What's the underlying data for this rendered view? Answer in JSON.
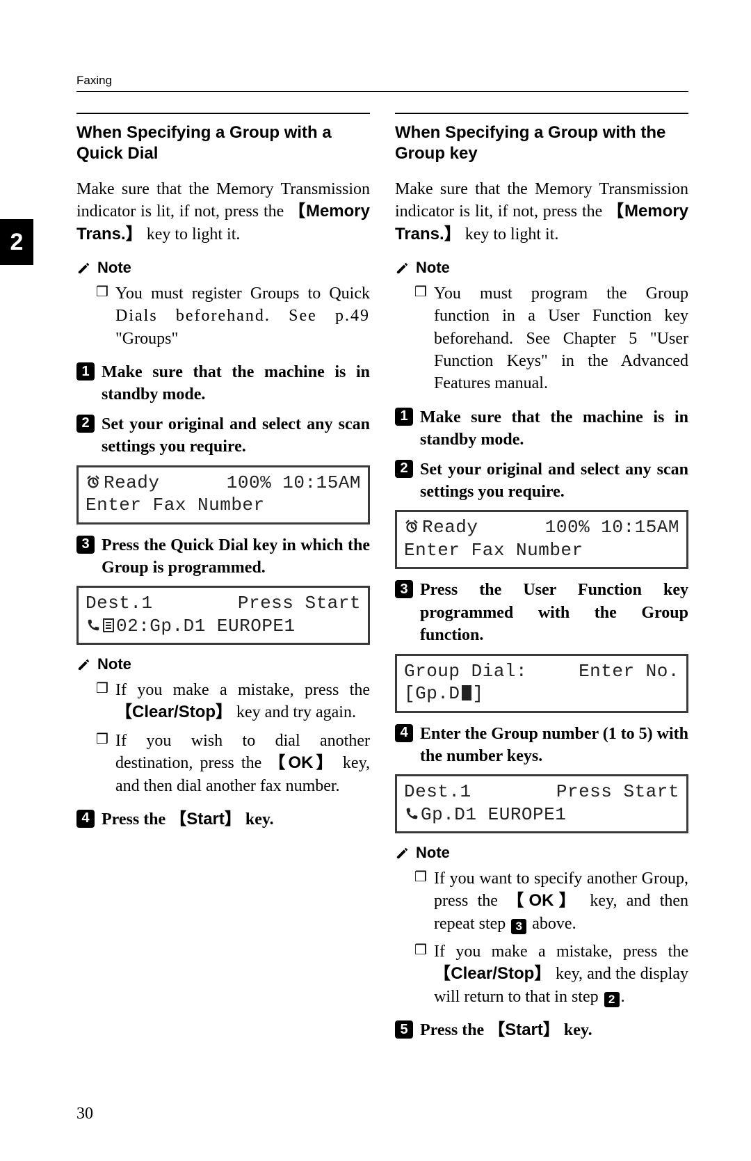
{
  "page": {
    "number": "30",
    "running_header": "Faxing",
    "tab_label": "2"
  },
  "keys": {
    "memory_trans": "Memory Trans.",
    "clear_stop": "Clear/Stop",
    "ok": "OK",
    "start": "Start"
  },
  "note_label": "Note",
  "left": {
    "heading": "When Specifying a Group with a Quick Dial",
    "intro_pre": "Make sure that the Memory Transmission indicator is lit, if not, press the ",
    "intro_post": " key to light it.",
    "note1_pre": "You must register Groups to Quick ",
    "note1_tracked": "Dials beforehand. See p.49",
    "note1_post": " \"Groups\"",
    "step1": "Make sure that the machine is in standby mode.",
    "step2": "Set your original and select any scan settings you require.",
    "lcd1": {
      "row1_left": "Ready",
      "row1_right": "100% 10:15AM",
      "row2": "Enter Fax Number"
    },
    "step3": "Press the Quick Dial key in which the Group is programmed.",
    "lcd2": {
      "row1_left": "Dest.1",
      "row1_right": "Press Start",
      "row2": "02:Gp.D1 EUROPE1"
    },
    "note2_a_pre": "If you make a mistake, press the ",
    "note2_a_post": " key and try again.",
    "note2_b_pre": "If you wish to dial another destination, press the ",
    "note2_b_post": " key, and then dial another fax number.",
    "step4_pre": "Press the ",
    "step4_post": " key."
  },
  "right": {
    "heading": "When Specifying a Group with the Group key",
    "intro_pre": "Make sure that the Memory Transmission indicator is lit, if not, press the ",
    "intro_post": " key to light it.",
    "note1": "You must program the Group function in a User Function key beforehand. See Chapter 5 \"User Function Keys\" in the Advanced Features manual.",
    "step1": "Make sure that the machine is in standby mode.",
    "step2": "Set your original and select any scan settings you require.",
    "lcd1": {
      "row1_left": "Ready",
      "row1_right": "100% 10:15AM",
      "row2": "Enter Fax Number"
    },
    "step3": "Press the User Function key programmed with the Group function.",
    "lcd2": {
      "row1_left": "Group Dial:",
      "row1_right": "Enter No.",
      "row2_pre": "[Gp.D",
      "row2_post": "]"
    },
    "step4": "Enter the Group number (1 to 5) with the number keys.",
    "lcd3": {
      "row1_left": "Dest.1",
      "row1_right": "Press Start",
      "row2": "Gp.D1 EUROPE1"
    },
    "note2_a_pre": "If you want to specify another Group, press the ",
    "note2_a_mid": " key, and then repeat step ",
    "note2_a_step": "3",
    "note2_a_post": " above.",
    "note2_b_pre": "If you make a mistake, press the ",
    "note2_b_mid": " key, and the display will return to that in step ",
    "note2_b_step": "2",
    "note2_b_post": ".",
    "step5_pre": "Press the ",
    "step5_post": " key."
  }
}
